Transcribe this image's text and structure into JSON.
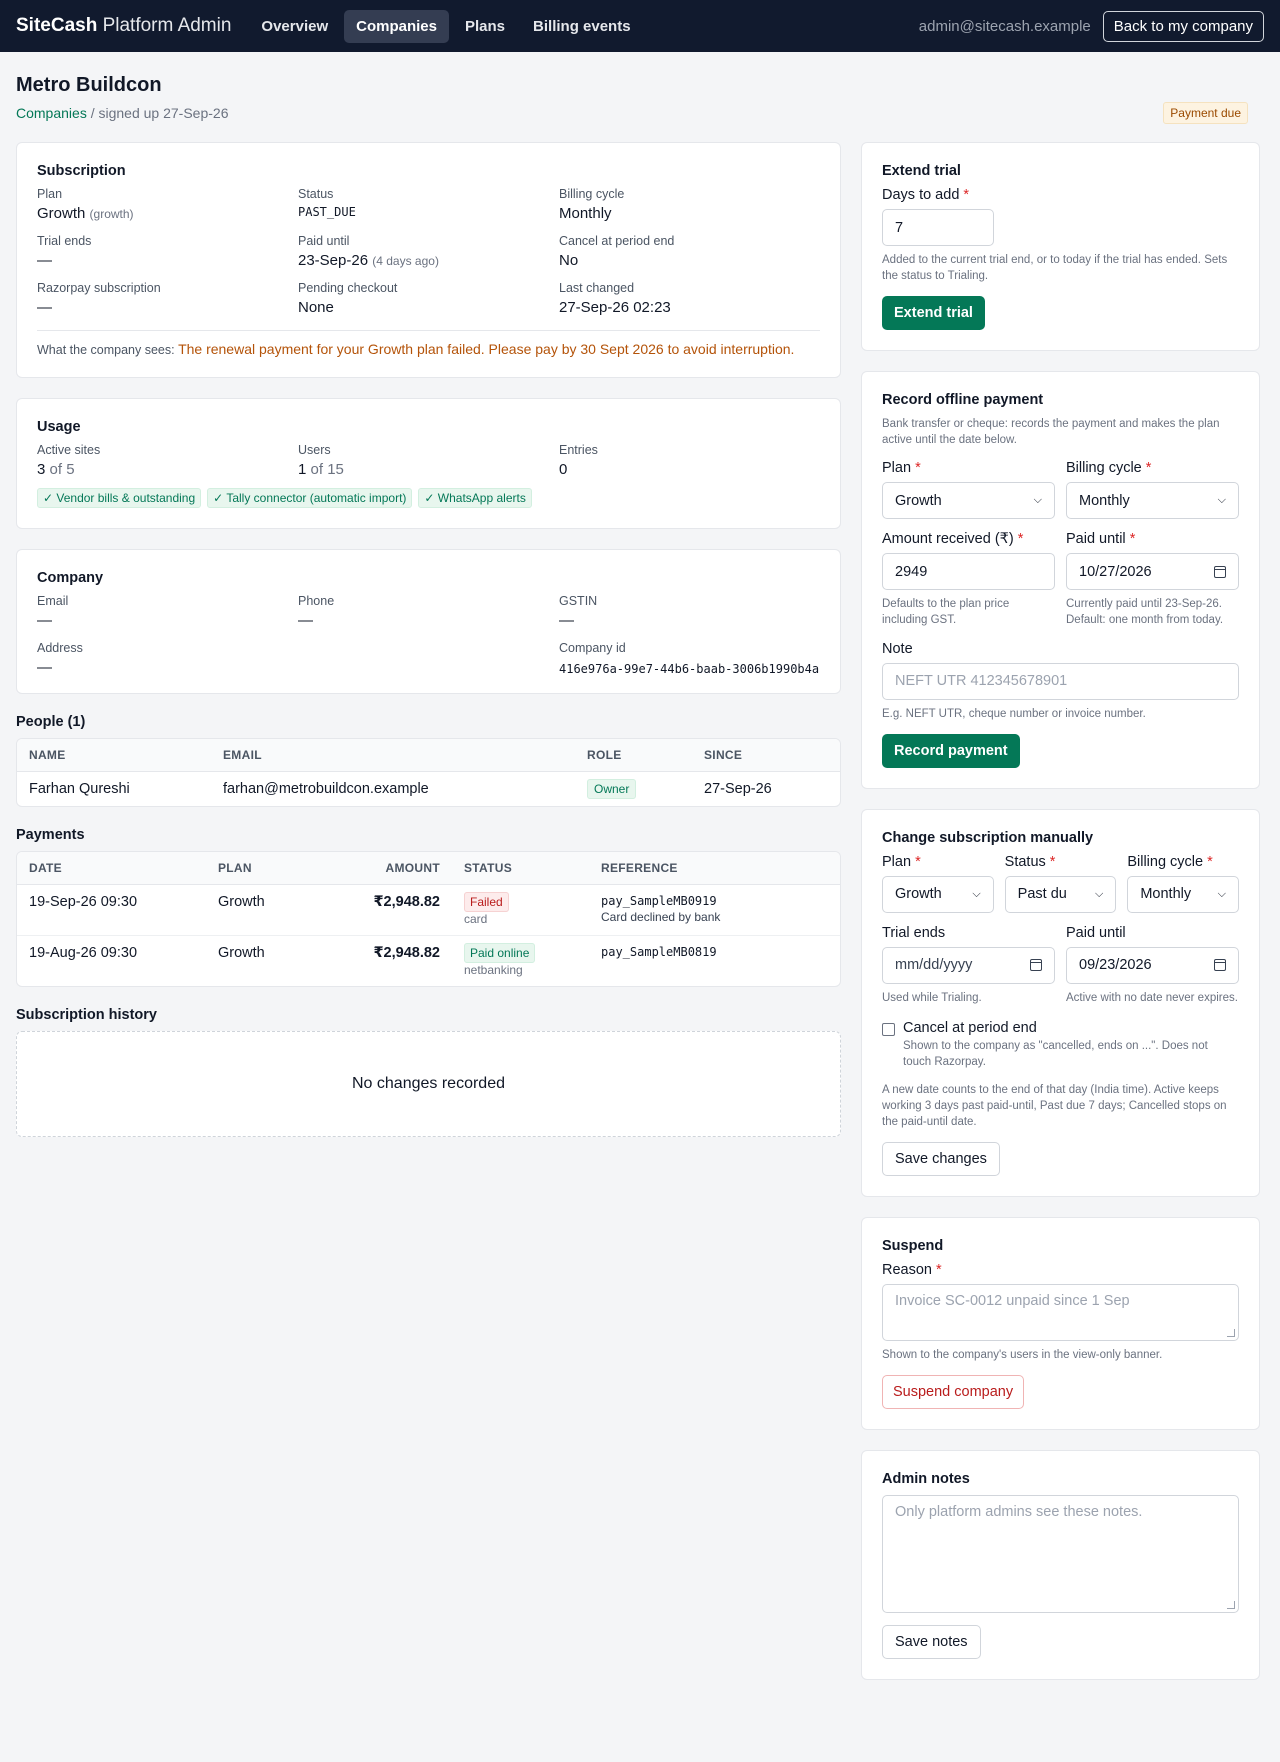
{
  "topbar": {
    "brand_bold": "SiteCash",
    "brand_rest": "Platform Admin",
    "nav": [
      "Overview",
      "Companies",
      "Plans",
      "Billing events"
    ],
    "user_email": "admin@sitecash.example",
    "back_button": "Back to my company"
  },
  "header": {
    "title": "Metro Buildcon",
    "breadcrumb_link": "Companies",
    "breadcrumb_rest": "/ signed up 27-Sep-26",
    "status_badge": "Payment due"
  },
  "subscription": {
    "title": "Subscription",
    "plan_label": "Plan",
    "plan_value": "Growth",
    "plan_code": "(growth)",
    "status_label": "Status",
    "status_value": "PAST_DUE",
    "billing_label": "Billing cycle",
    "billing_value": "Monthly",
    "trial_label": "Trial ends",
    "trial_value": "—",
    "paid_label": "Paid until",
    "paid_value": "23-Sep-26",
    "paid_note": "(4 days ago)",
    "cancel_label": "Cancel at period end",
    "cancel_value": "No",
    "razorpay_label": "Razorpay subscription",
    "razorpay_value": "—",
    "pending_label": "Pending checkout",
    "pending_value": "None",
    "changed_label": "Last changed",
    "changed_value": "27-Sep-26 02:23",
    "seen_label": "What the company sees:",
    "seen_text": "The renewal payment for your Growth plan failed. Please pay by 30 Sept 2026 to avoid interruption."
  },
  "usage": {
    "title": "Usage",
    "sites_label": "Active sites",
    "sites_used": "3",
    "sites_limit": "of 5",
    "users_label": "Users",
    "users_used": "1",
    "users_limit": "of 15",
    "entries_label": "Entries",
    "entries_value": "0",
    "features": [
      "✓ Vendor bills & outstanding",
      "✓ Tally connector (automatic import)",
      "✓ WhatsApp alerts"
    ]
  },
  "company": {
    "title": "Company",
    "email_label": "Email",
    "email_value": "—",
    "phone_label": "Phone",
    "phone_value": "—",
    "gstin_label": "GSTIN",
    "gstin_value": "—",
    "address_label": "Address",
    "address_value": "—",
    "id_label": "Company id",
    "id_value": "416e976a-99e7-44b6-baab-3006b1990b4a"
  },
  "people": {
    "title": "People (1)",
    "columns": [
      "NAME",
      "EMAIL",
      "ROLE",
      "SINCE"
    ],
    "rows": [
      {
        "name": "Farhan Qureshi",
        "email": "farhan@metrobuildcon.example",
        "role": "Owner",
        "since": "27-Sep-26"
      }
    ]
  },
  "payments": {
    "title": "Payments",
    "columns": [
      "DATE",
      "PLAN",
      "AMOUNT",
      "STATUS",
      "REFERENCE"
    ],
    "rows": [
      {
        "date": "19-Sep-26 09:30",
        "plan": "Growth",
        "amount": "₹2,948.82",
        "status": "Failed",
        "method": "card",
        "ref": "pay_SampleMB0919",
        "ref_note": "Card declined by bank"
      },
      {
        "date": "19-Aug-26 09:30",
        "plan": "Growth",
        "amount": "₹2,948.82",
        "status": "Paid online",
        "method": "netbanking",
        "ref": "pay_SampleMB0819",
        "ref_note": ""
      }
    ]
  },
  "history": {
    "title": "Subscription history",
    "empty": "No changes recorded"
  },
  "extend_trial": {
    "title": "Extend trial",
    "days_label": "Days to add",
    "days_value": "7",
    "hint": "Added to the current trial end, or to today if the trial has ended. Sets the status to Trialing.",
    "button": "Extend trial"
  },
  "offline_payment": {
    "title": "Record offline payment",
    "intro": "Bank transfer or cheque: records the payment and makes the plan active until the date below.",
    "plan_label": "Plan",
    "plan_value": "Growth",
    "cycle_label": "Billing cycle",
    "cycle_value": "Monthly",
    "amount_label": "Amount received (₹)",
    "amount_value": "2949",
    "amount_hint": "Defaults to the plan price including GST.",
    "paid_label": "Paid until",
    "paid_value": "10/27/2026",
    "paid_hint": "Currently paid until 23-Sep-26. Default: one month from today.",
    "note_label": "Note",
    "note_placeholder": "NEFT UTR 412345678901",
    "note_hint": "E.g. NEFT UTR, cheque number or invoice number.",
    "button": "Record payment"
  },
  "change_sub": {
    "title": "Change subscription manually",
    "plan_label": "Plan",
    "plan_value": "Growth",
    "status_label": "Status",
    "status_value": "Past du",
    "cycle_label": "Billing cycle",
    "cycle_value": "Monthly",
    "trial_label": "Trial ends",
    "trial_value": "mm/dd/yyyy",
    "trial_hint": "Used while Trialing.",
    "paid_label": "Paid until",
    "paid_value": "09/23/2026",
    "paid_hint": "Active with no date never expires.",
    "cancel_label": "Cancel at period end",
    "cancel_hint": "Shown to the company as \"cancelled, ends on ...\". Does not touch Razorpay.",
    "rules_hint": "A new date counts to the end of that day (India time). Active keeps working 3 days past paid-until, Past due 7 days; Cancelled stops on the paid-until date.",
    "button": "Save changes"
  },
  "suspend": {
    "title": "Suspend",
    "reason_label": "Reason",
    "reason_placeholder": "Invoice SC-0012 unpaid since 1 Sep",
    "hint": "Shown to the company's users in the view-only banner.",
    "button": "Suspend company"
  },
  "admin_notes": {
    "title": "Admin notes",
    "placeholder": "Only platform admins see these notes.",
    "button": "Save notes"
  }
}
